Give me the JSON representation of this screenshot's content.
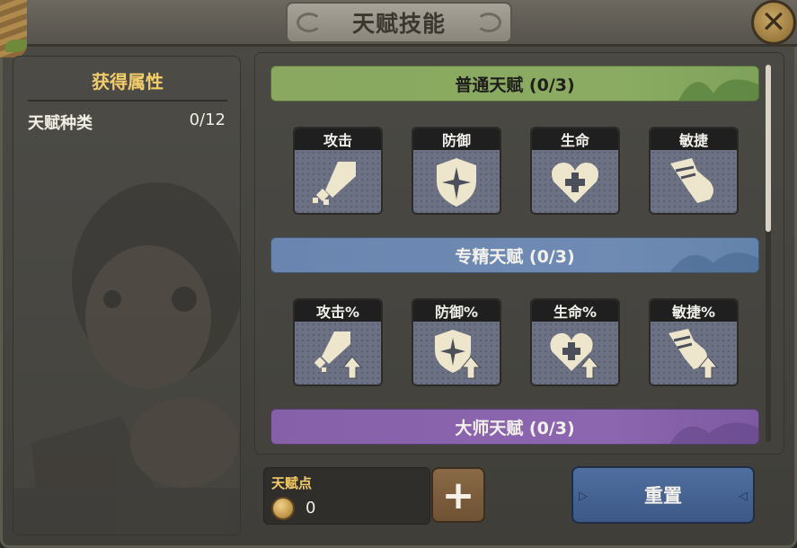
{
  "window": {
    "title": "天赋技能",
    "close_icon": "close-x-icon"
  },
  "left_panel": {
    "title": "获得属性",
    "stat_label": "天赋种类",
    "stat_value": "0/12"
  },
  "sections": [
    {
      "title": "普通天赋 (0/3)",
      "color": "#8aa85f",
      "skills": [
        {
          "label": "攻击",
          "icon": "attack-icon"
        },
        {
          "label": "防御",
          "icon": "defense-shield-icon"
        },
        {
          "label": "生命",
          "icon": "life-heart-icon"
        },
        {
          "label": "敏捷",
          "icon": "agility-boot-icon"
        }
      ]
    },
    {
      "title": "专精天赋 (0/3)",
      "color": "#6a86b0",
      "skills": [
        {
          "label": "攻击%",
          "icon": "attack-percent-icon"
        },
        {
          "label": "防御%",
          "icon": "defense-percent-icon"
        },
        {
          "label": "生命%",
          "icon": "life-percent-icon"
        },
        {
          "label": "敏捷%",
          "icon": "agility-percent-icon"
        }
      ]
    },
    {
      "title": "大师天赋 (0/3)",
      "color": "#8661aa"
    }
  ],
  "talent_points": {
    "label": "天赋点",
    "value": "0",
    "icon": "talent-coin-icon"
  },
  "buttons": {
    "add": "+",
    "reset": "重置"
  }
}
